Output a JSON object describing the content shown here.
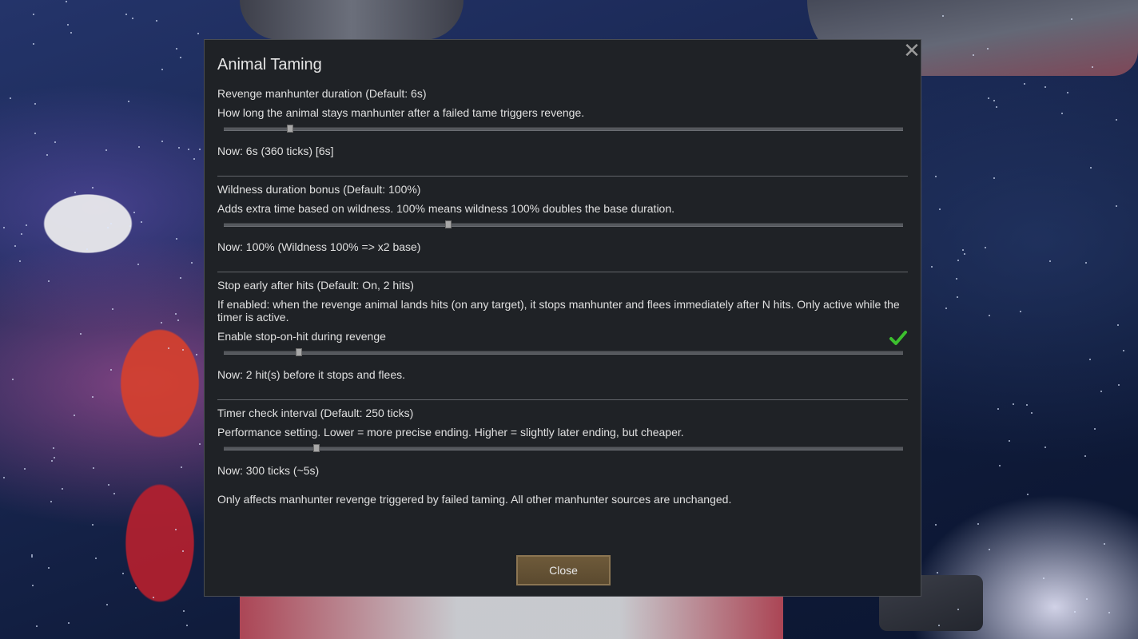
{
  "dialog": {
    "title": "Animal Taming",
    "close_icon": "close-icon",
    "close_button_label": "Close"
  },
  "sections": [
    {
      "heading": "Revenge manhunter duration (Default: 6s)",
      "description": "How long the animal stays manhunter after a failed tame triggers revenge.",
      "slider_fraction": 0.098,
      "now": "Now: 6s (360 ticks) [6s]"
    },
    {
      "heading": "Wildness duration bonus (Default: 100%)",
      "description": "Adds extra time based on wildness. 100% means wildness 100% doubles the base duration.",
      "slider_fraction": 0.33,
      "now": "Now: 100% (Wildness 100% => x2 base)"
    },
    {
      "heading": "Stop early after hits (Default: On, 2 hits)",
      "description": "If enabled: when the revenge animal lands hits (on any target), it stops manhunter and flees immediately after N hits. Only active while the timer is active.",
      "toggle_label": "Enable stop-on-hit during revenge",
      "toggle_on": true,
      "slider_fraction": 0.11,
      "now": "Now: 2 hit(s) before it stops and flees."
    },
    {
      "heading": "Timer check interval (Default: 250 ticks)",
      "description": "Performance setting. Lower = more precise ending. Higher = slightly later ending, but cheaper.",
      "slider_fraction": 0.136,
      "now": "Now: 300 ticks (~5s)"
    }
  ],
  "footer_note": "Only affects manhunter revenge triggered by failed taming. All other manhunter sources are unchanged.",
  "colors": {
    "checkmark": "#3cbf2e",
    "button": "#5b4a2f"
  }
}
